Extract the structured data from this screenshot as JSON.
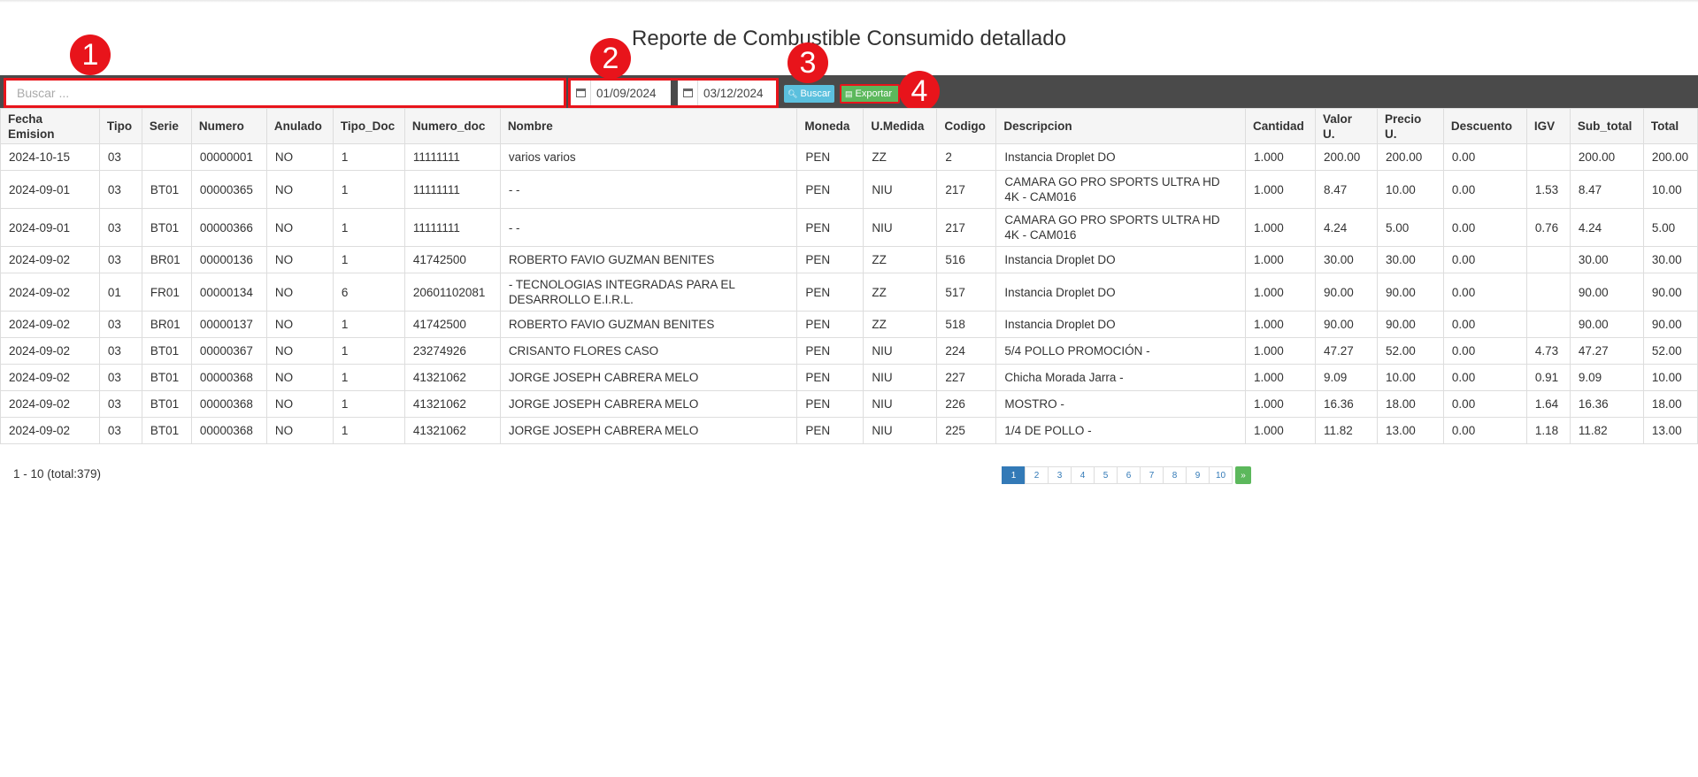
{
  "title": "Reporte de Combustible Consumido detallado",
  "search": {
    "placeholder": "Buscar ..."
  },
  "dates": {
    "from": "01/09/2024",
    "to": "03/12/2024"
  },
  "buttons": {
    "search": "Buscar",
    "export": "Exportar"
  },
  "badges": [
    "1",
    "2",
    "3",
    "4"
  ],
  "table": {
    "headers": [
      [
        "Fecha",
        "Emision"
      ],
      [
        "Tipo"
      ],
      [
        "Serie"
      ],
      [
        "Numero"
      ],
      [
        "Anulado"
      ],
      [
        "Tipo_Doc"
      ],
      [
        "Numero_doc"
      ],
      [
        "Nombre"
      ],
      [
        "Moneda"
      ],
      [
        "U.Medida"
      ],
      [
        "Codigo"
      ],
      [
        "Descripcion"
      ],
      [
        "Cantidad"
      ],
      [
        "Valor",
        "U."
      ],
      [
        "Precio",
        "U."
      ],
      [
        "Descuento"
      ],
      [
        "IGV"
      ],
      [
        "Sub_total"
      ],
      [
        "Total"
      ]
    ],
    "rows": [
      [
        "2024-10-15",
        "03",
        "",
        "00000001",
        "NO",
        "1",
        "11111111",
        "varios varios",
        "PEN",
        "ZZ",
        "2",
        "Instancia Droplet DO",
        "1.000",
        "200.00",
        "200.00",
        "0.00",
        "",
        "200.00",
        "200.00"
      ],
      [
        "2024-09-01",
        "03",
        "BT01",
        "00000365",
        "NO",
        "1",
        "11111111",
        "- -",
        "PEN",
        "NIU",
        "217",
        "CAMARA GO PRO SPORTS ULTRA HD 4K - CAM016",
        "1.000",
        "8.47",
        "10.00",
        "0.00",
        "1.53",
        "8.47",
        "10.00"
      ],
      [
        "2024-09-01",
        "03",
        "BT01",
        "00000366",
        "NO",
        "1",
        "11111111",
        "- -",
        "PEN",
        "NIU",
        "217",
        "CAMARA GO PRO SPORTS ULTRA HD 4K - CAM016",
        "1.000",
        "4.24",
        "5.00",
        "0.00",
        "0.76",
        "4.24",
        "5.00"
      ],
      [
        "2024-09-02",
        "03",
        "BR01",
        "00000136",
        "NO",
        "1",
        "41742500",
        "ROBERTO FAVIO GUZMAN BENITES",
        "PEN",
        "ZZ",
        "516",
        "Instancia Droplet DO",
        "1.000",
        "30.00",
        "30.00",
        "0.00",
        "",
        "30.00",
        "30.00"
      ],
      [
        "2024-09-02",
        "01",
        "FR01",
        "00000134",
        "NO",
        "6",
        "20601102081",
        "- TECNOLOGIAS INTEGRADAS PARA EL DESARROLLO E.I.R.L.",
        "PEN",
        "ZZ",
        "517",
        "Instancia Droplet DO",
        "1.000",
        "90.00",
        "90.00",
        "0.00",
        "",
        "90.00",
        "90.00"
      ],
      [
        "2024-09-02",
        "03",
        "BR01",
        "00000137",
        "NO",
        "1",
        "41742500",
        "ROBERTO FAVIO GUZMAN BENITES",
        "PEN",
        "ZZ",
        "518",
        "Instancia Droplet DO",
        "1.000",
        "90.00",
        "90.00",
        "0.00",
        "",
        "90.00",
        "90.00"
      ],
      [
        "2024-09-02",
        "03",
        "BT01",
        "00000367",
        "NO",
        "1",
        "23274926",
        "CRISANTO FLORES CASO",
        "PEN",
        "NIU",
        "224",
        "5/4 POLLO PROMOCIÓN -",
        "1.000",
        "47.27",
        "52.00",
        "0.00",
        "4.73",
        "47.27",
        "52.00"
      ],
      [
        "2024-09-02",
        "03",
        "BT01",
        "00000368",
        "NO",
        "1",
        "41321062",
        "JORGE JOSEPH CABRERA MELO",
        "PEN",
        "NIU",
        "227",
        "Chicha Morada Jarra -",
        "1.000",
        "9.09",
        "10.00",
        "0.00",
        "0.91",
        "9.09",
        "10.00"
      ],
      [
        "2024-09-02",
        "03",
        "BT01",
        "00000368",
        "NO",
        "1",
        "41321062",
        "JORGE JOSEPH CABRERA MELO",
        "PEN",
        "NIU",
        "226",
        "MOSTRO -",
        "1.000",
        "16.36",
        "18.00",
        "0.00",
        "1.64",
        "16.36",
        "18.00"
      ],
      [
        "2024-09-02",
        "03",
        "BT01",
        "00000368",
        "NO",
        "1",
        "41321062",
        "JORGE JOSEPH CABRERA MELO",
        "PEN",
        "NIU",
        "225",
        "1/4 DE POLLO -",
        "1.000",
        "11.82",
        "13.00",
        "0.00",
        "1.18",
        "11.82",
        "13.00"
      ]
    ]
  },
  "footer": {
    "count": "1 - 10 (total:379)"
  },
  "pagination": {
    "pages": [
      "1",
      "2",
      "3",
      "4",
      "5",
      "6",
      "7",
      "8",
      "9",
      "10"
    ],
    "next": "»",
    "active": "1"
  }
}
